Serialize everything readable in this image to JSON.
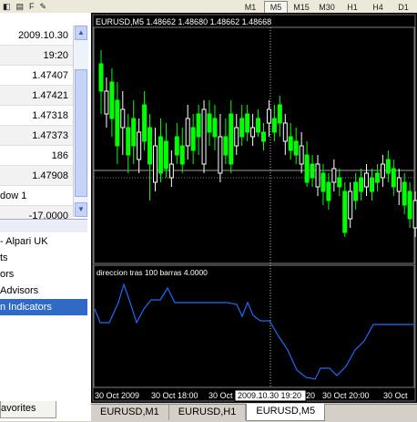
{
  "toolbar": {
    "left_buttons": [
      "◧",
      "▤",
      "F",
      "✎"
    ],
    "timeframes": [
      "M1",
      "M5",
      "M15",
      "M30",
      "H1",
      "H4",
      "D1"
    ],
    "active_timeframe": "M5"
  },
  "market_watch": {
    "rows": [
      {
        "value": "2009.10.30"
      },
      {
        "value": "19:20"
      },
      {
        "value": "1.47407"
      },
      {
        "value": "1.47421"
      },
      {
        "value": "1.47318"
      },
      {
        "value": "1.47373"
      },
      {
        "value": "186"
      },
      {
        "value": "1.47908"
      },
      {
        "value": "dow 1"
      },
      {
        "value": "-17.0000"
      }
    ]
  },
  "navigator": {
    "items": [
      {
        "label": "- Alpari UK"
      },
      {
        "label": "ts"
      },
      {
        "label": "ors"
      },
      {
        "label": " Advisors"
      },
      {
        "label": "n Indicators"
      }
    ],
    "selected_index": 4,
    "favorites_tab": "avorites"
  },
  "chart": {
    "header": "EURUSD,M5  1.48662 1.48680 1.48662 1.48668",
    "indicator_label": "direccion tras 100 barras 4.0000",
    "time_labels": [
      "30 Oct 2009",
      "30 Oct 18:00",
      "30 Oct 19",
      "20",
      "30 Oct 20:00",
      "30 Oct"
    ],
    "crosshair_time": "2009.10.30 19:20",
    "colors": {
      "background": "#000000",
      "bull": "#00ff00",
      "bear": "#ffffff",
      "indicator": "#1e6bff",
      "grid": "#808080"
    }
  },
  "tabs": [
    {
      "label": "EURUSD,M1"
    },
    {
      "label": "EURUSD,H1"
    },
    {
      "label": "EURUSD,M5"
    }
  ],
  "active_tab": 2
}
